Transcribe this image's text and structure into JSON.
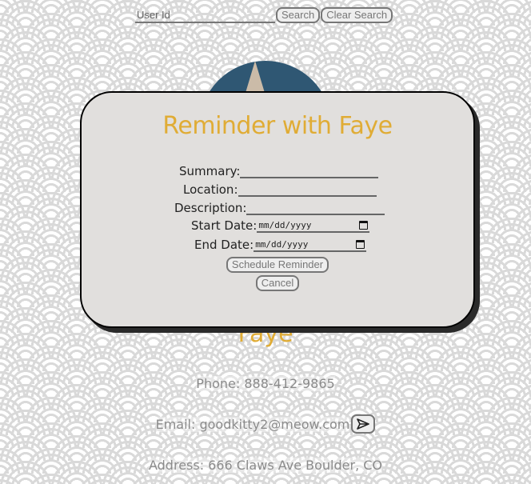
{
  "search": {
    "placeholder": "User Id",
    "search_label": "Search",
    "clear_label": "Clear Search"
  },
  "profile": {
    "name": "Faye",
    "phone": "Phone: 888-412-9865",
    "email": "Email: goodkitty2@meow.com",
    "address": "Address: 666 Claws Ave Boulder, CO"
  },
  "modal": {
    "title": "Reminder with Faye",
    "fields": {
      "summary": "Summary:",
      "location": "Location:",
      "description": "Description:",
      "start_date": "Start Date:",
      "end_date": "End Date:"
    },
    "date_placeholder": "mm/dd/yyyy",
    "schedule_label": "Schedule Reminder",
    "cancel_label": "Cancel"
  },
  "colors": {
    "accent": "#e0ac35",
    "modal_bg": "#e1dfdd"
  },
  "icons": [
    "calendar-icon",
    "send-icon"
  ]
}
